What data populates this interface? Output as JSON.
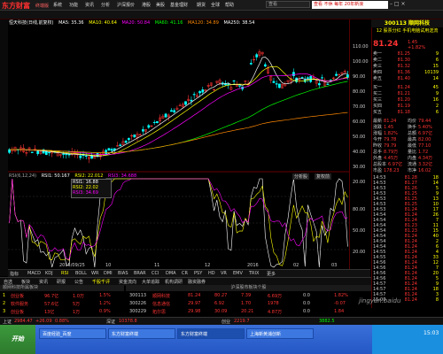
{
  "app": {
    "logo": "东方财富",
    "logo_sub": "终端版",
    "menus": [
      "系统",
      "功能",
      "资讯",
      "分析",
      "沪深报价",
      "港股",
      "美股",
      "基金理财",
      "期货",
      "全球",
      "帮助"
    ],
    "search_placeholder": "查看",
    "promo": "查看 不休 每年 20年新浪",
    "window_controls": "– □ ×"
  },
  "chart": {
    "header_items": [
      {
        "label": "恒天科技(日线,前复权)",
        "color": "#ffffff"
      },
      {
        "label": "MA5: 35.36",
        "color": "#ffffff"
      },
      {
        "label": "MA10: 40.64",
        "color": "#ffff00"
      },
      {
        "label": "MA20: 50.84",
        "color": "#ff00ff"
      },
      {
        "label": "MA60: 41.16",
        "color": "#00ff00"
      },
      {
        "label": "MA120: 34.89",
        "color": "#ff8800"
      },
      {
        "label": "MA250: 38.54",
        "color": "#ffffff"
      }
    ],
    "indicator_header": [
      {
        "label": "RSI(6,12,24)",
        "color": "#aaaaaa"
      },
      {
        "label": "RSI1: 50.167",
        "color": "#ffffff"
      },
      {
        "label": "RSI2: 22.012",
        "color": "#ffff00"
      },
      {
        "label": "RSI3: 34.688",
        "color": "#ff00ff"
      }
    ],
    "price_axis": [
      "110.00",
      "100.00",
      "90.00",
      "80.00",
      "70.00",
      "60.00",
      "50.00",
      "40.00",
      "30.00",
      "20.00"
    ],
    "indicator_axis": [
      "80.00",
      "50.00",
      "20.00"
    ],
    "date_axis": [
      "2015/09/25",
      "10",
      "11",
      "12",
      "2016",
      "02",
      "03"
    ],
    "tooltip_lines": [
      "RSI1: 16.88",
      "RSI2: 22.02",
      "RSI3: 34.69"
    ],
    "buttons": [
      "分析股",
      "复权前"
    ],
    "tabs": [
      "指标",
      "MACD",
      "KDJ",
      "RSI",
      "BOLL",
      "WR",
      "DMI",
      "BIAS",
      "BRAR",
      "CCI",
      "DMA",
      "CR",
      "PSY",
      "HD",
      "VR",
      "EMV",
      "TRIX",
      "更多"
    ],
    "active_tab": "RSI"
  },
  "right_panel": {
    "code_name": "300113 顺网科技",
    "news": "12 股票分红 手机电脑试用送流",
    "price": "81.24",
    "change": "1.45",
    "change_pct": "+1.82%",
    "sell": [
      {
        "label": "卖五",
        "price": "81.40",
        "vol": "14"
      },
      {
        "label": "卖四",
        "price": "81.36",
        "vol": "10139"
      },
      {
        "label": "卖三",
        "price": "81.32",
        "vol": "15"
      },
      {
        "label": "卖二",
        "price": "81.30",
        "vol": "6"
      },
      {
        "label": "卖一",
        "price": "81.25",
        "vol": "9"
      }
    ],
    "buy": [
      {
        "label": "买一",
        "price": "81.24",
        "vol": "45"
      },
      {
        "label": "买二",
        "price": "81.21",
        "vol": "9"
      },
      {
        "label": "买三",
        "price": "81.20",
        "vol": "16"
      },
      {
        "label": "买四",
        "price": "81.19",
        "vol": "2"
      },
      {
        "label": "买五",
        "price": "81.18",
        "vol": "6"
      }
    ],
    "stats": [
      {
        "l1": "最新",
        "v1": "81.24",
        "l2": "均价",
        "v2": "79.44"
      },
      {
        "l1": "涨跌",
        "v1": "1.45",
        "l2": "换手",
        "v2": "5.40%"
      },
      {
        "l1": "涨幅",
        "v1": "1.82%",
        "l2": "总额",
        "v2": "6.97亿"
      },
      {
        "l1": "今开",
        "v1": "79.78",
        "l2": "最高",
        "v2": "82.00"
      },
      {
        "l1": "昨收",
        "v1": "79.79",
        "l2": "最低",
        "v2": "77.10"
      },
      {
        "l1": "总手",
        "v1": "8.79万",
        "l2": "量比",
        "v2": "1.72"
      },
      {
        "l1": "外盘",
        "v1": "4.45万",
        "l2": "内盘",
        "v2": "4.34万"
      },
      {
        "l1": "总股本",
        "v1": "6.97亿",
        "l2": "流通",
        "v2": "3.32亿"
      },
      {
        "l1": "市盈",
        "v1": "178.23",
        "l2": "市净",
        "v2": "16.02"
      }
    ],
    "ticks": [
      {
        "t": "14:53",
        "p": "81.28",
        "v": "18"
      },
      {
        "t": "14:53",
        "p": "81.27",
        "v": "14"
      },
      {
        "t": "14:53",
        "p": "81.26",
        "v": "5"
      },
      {
        "t": "14:53",
        "p": "81.25",
        "v": "9"
      },
      {
        "t": "14:53",
        "p": "81.25",
        "v": "13"
      },
      {
        "t": "14:53",
        "p": "81.25",
        "v": "10"
      },
      {
        "t": "14:53",
        "p": "81.24",
        "v": "17"
      },
      {
        "t": "14:54",
        "p": "81.24",
        "v": "26"
      },
      {
        "t": "14:54",
        "p": "81.24",
        "v": "7"
      },
      {
        "t": "14:54",
        "p": "81.23",
        "v": "11"
      },
      {
        "t": "14:54",
        "p": "81.23",
        "v": "15"
      },
      {
        "t": "14:54",
        "p": "81.24",
        "v": "40"
      },
      {
        "t": "14:54",
        "p": "81.24",
        "v": "2"
      },
      {
        "t": "14:54",
        "p": "81.24",
        "v": "6"
      },
      {
        "t": "14:55",
        "p": "81.24",
        "v": "4"
      },
      {
        "t": "14:55",
        "p": "81.24",
        "v": "33"
      },
      {
        "t": "14:56",
        "p": "81.24",
        "v": "12"
      },
      {
        "t": "14:56",
        "p": "81.24",
        "v": "7"
      },
      {
        "t": "14:56",
        "p": "81.24",
        "v": "20"
      },
      {
        "t": "14:56",
        "p": "81.24",
        "v": "5"
      },
      {
        "t": "14:57",
        "p": "81.24",
        "v": "9"
      },
      {
        "t": "14:57",
        "p": "81.24",
        "v": "18"
      },
      {
        "t": "14:57",
        "p": "81.24",
        "v": "3"
      },
      {
        "t": "15:00",
        "p": "81.24",
        "v": "8"
      }
    ]
  },
  "bottom": {
    "tabs": [
      "自选",
      "板块",
      "资讯",
      "研报",
      "公告",
      "千股千评",
      "资金流向",
      "大单追踪",
      "机构调研",
      "融资融券"
    ],
    "active_tab": "千股千评",
    "left_header": "顺网科技所属板块",
    "left_rows": [
      {
        "name": "创业板",
        "v1": "96.7亿",
        "v2": "1.0万",
        "v3": "1.5%"
      },
      {
        "name": "软件服务",
        "v1": "57.6亿",
        "v2": "5万",
        "v3": "1.2%"
      },
      {
        "name": "创业板",
        "v1": "13亿",
        "v2": "1万",
        "v3": "0.9%"
      }
    ],
    "mid_header": "沪深股市板块个股",
    "mid_rows": [
      {
        "code": "300113",
        "name": "顺网科技",
        "a": "81.24",
        "b": "80.27",
        "c": "7.39",
        "d": "6.69万",
        "e": "0.0",
        "f": "1.82%"
      },
      {
        "code": "300226",
        "name": "信息通信",
        "a": "29.97",
        "b": "6.92",
        "c": "1.70",
        "d": "1978",
        "e": "0.0",
        "f": "-0.07"
      },
      {
        "code": "300229",
        "name": "拓尔思",
        "a": "29.98",
        "b": "30.09",
        "c": "20.21",
        "d": "4.87万",
        "e": "0.0",
        "f": "1.84"
      }
    ]
  },
  "status": {
    "items": [
      {
        "label": "上证",
        "value": "2984.47",
        "color": "#ff3333"
      },
      {
        "label": "",
        "value": "+26.09",
        "color": "#ff3333"
      },
      {
        "label": "",
        "value": "0.88%",
        "color": "#ff3333"
      },
      {
        "label": "深证",
        "value": "10378.8",
        "color": "#ff3333"
      },
      {
        "label": "创业",
        "value": "2219.7",
        "color": "#ff3333"
      },
      {
        "label": "",
        "value": "3882.5",
        "color": "#00ff00"
      }
    ]
  },
  "taskbar": {
    "start": "开始",
    "tasks": [
      "百度经验_百度",
      "东方财富终端",
      "东方财富终端",
      "上海新黄浦创新"
    ],
    "clock": "15:03"
  },
  "watermark": "jingyan.baidu"
}
